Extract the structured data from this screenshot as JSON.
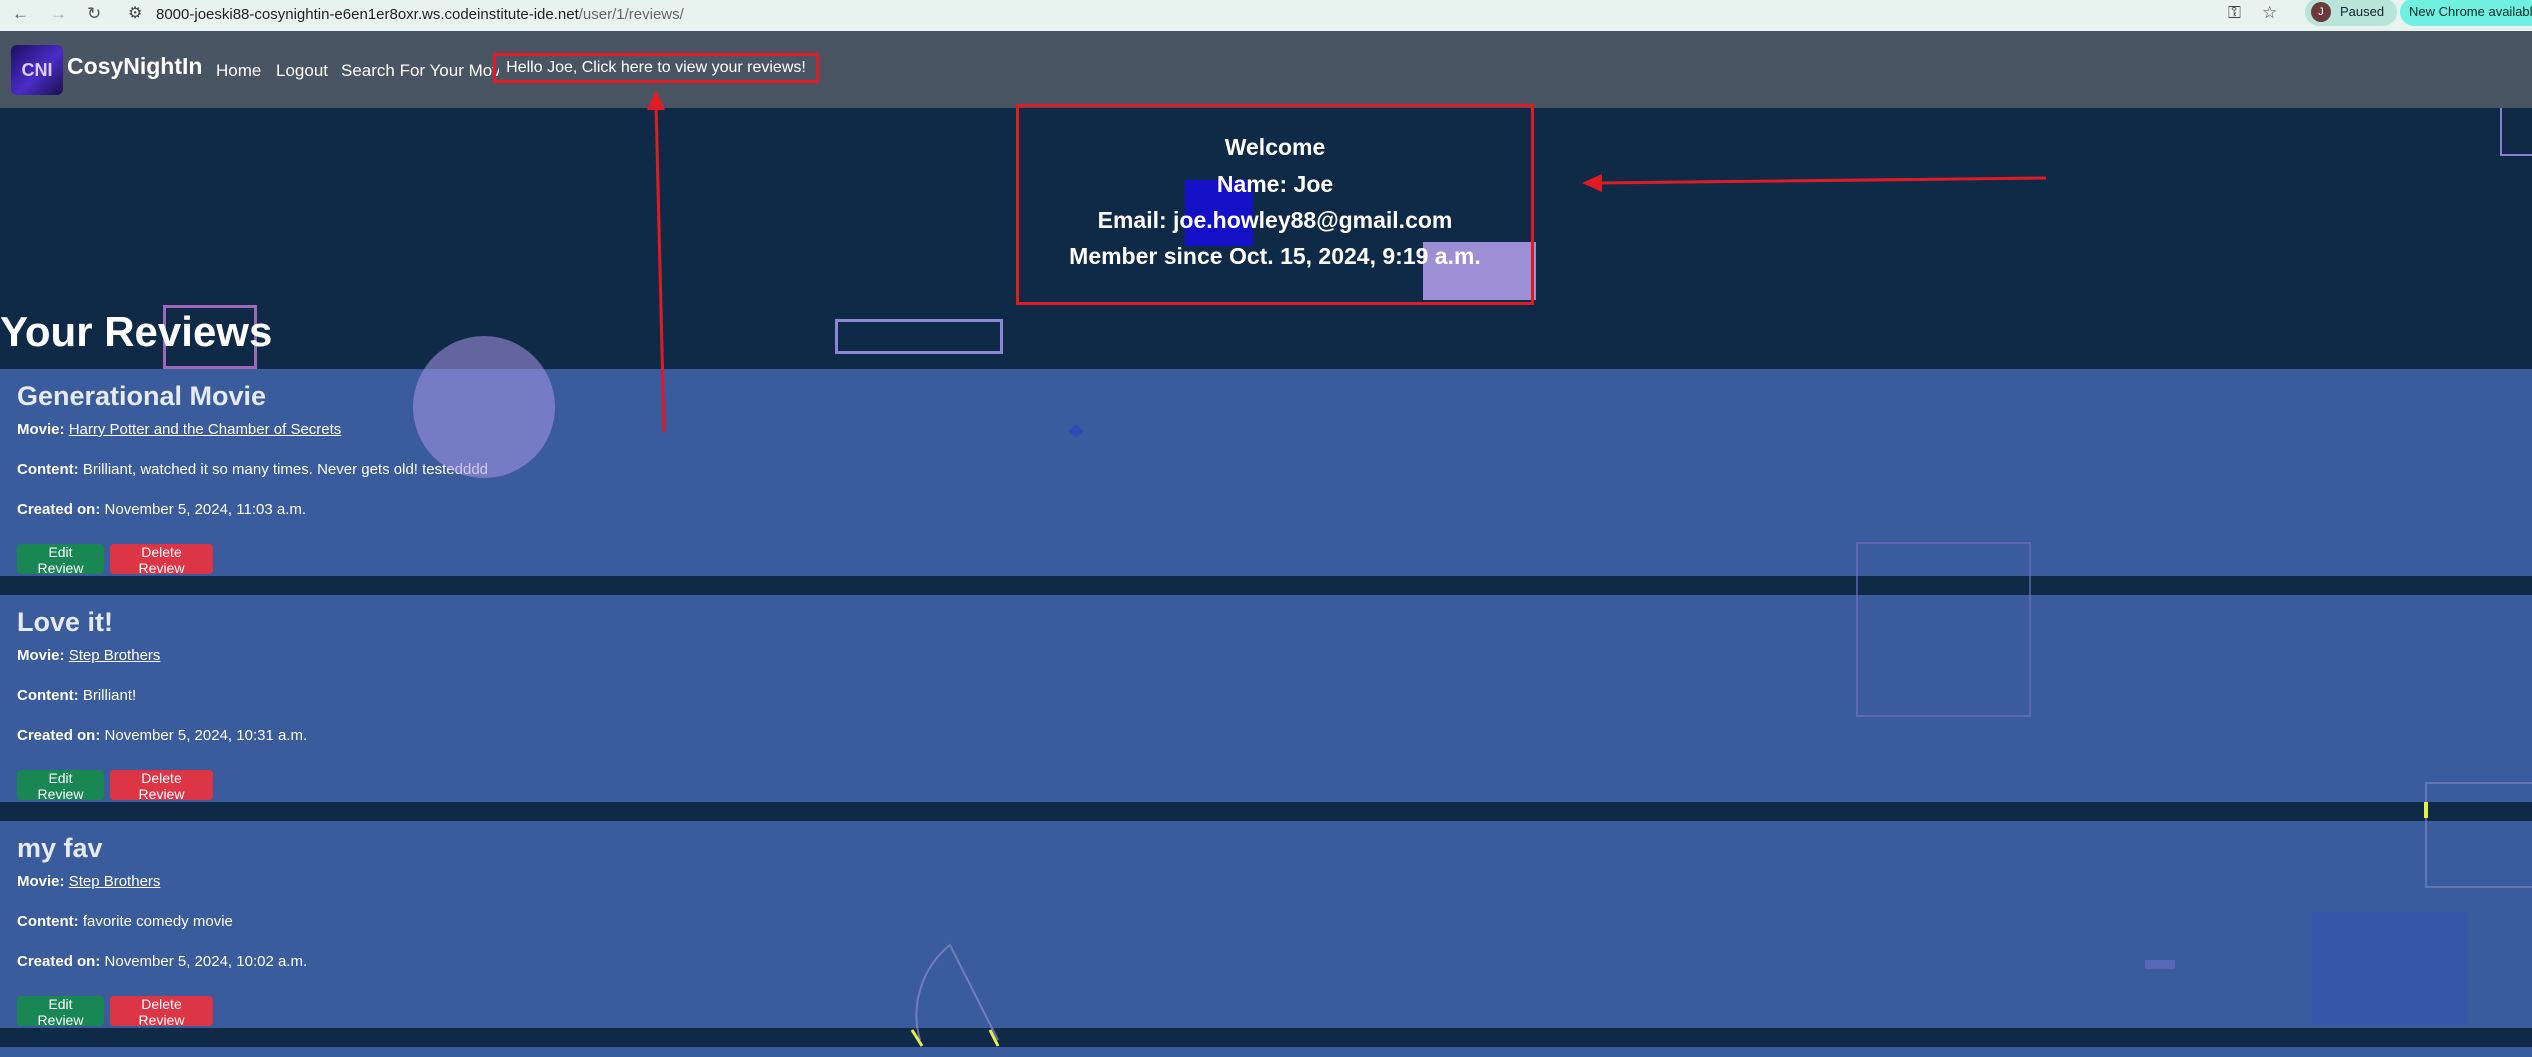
{
  "browser": {
    "url_host": "8000-joeski88-cosynightin-e6en1er8oxr.ws.codeinstitute-ide.net",
    "url_path": "/user/1/reviews/",
    "profile_initial": "J",
    "profile_status": "Paused",
    "update_label": "New Chrome available"
  },
  "navbar": {
    "logo_text": "CNI",
    "brand": "CosyNightIn",
    "links": [
      "Home",
      "Logout",
      "Search For Your Movie"
    ],
    "greeting": "Hello Joe, Click here to view your reviews!"
  },
  "welcome": {
    "title": "Welcome",
    "name": "Name: Joe",
    "email": "Email: joe.howley88@gmail.com",
    "member_since": "Member since Oct. 15, 2024, 9:19 a.m."
  },
  "reviews_heading": "Your Reviews",
  "labels": {
    "movie": "Movie:",
    "content": "Content:",
    "created": "Created on:",
    "edit": "Edit Review",
    "delete": "Delete Review"
  },
  "reviews": [
    {
      "title": "Generational Movie",
      "movie": "Harry Potter and the Chamber of Secrets",
      "content": "Brilliant, watched it so many times. Never gets old! testedddd",
      "created": "November 5, 2024, 11:03 a.m."
    },
    {
      "title": "Love it!",
      "movie": "Step Brothers",
      "content": "Brilliant!",
      "created": "November 5, 2024, 10:31 a.m."
    },
    {
      "title": "my fav",
      "movie": "Step Brothers",
      "content": "favorite comedy movie",
      "created": "November 5, 2024, 10:02 a.m."
    }
  ],
  "colors": {
    "page_bg": "#0e2a47",
    "navbar_bg": "#4a5563",
    "card_bg": "#3a5c9c",
    "edit_button": "#198754",
    "delete_button": "#dc3545",
    "annotation_red": "#e01b24"
  }
}
